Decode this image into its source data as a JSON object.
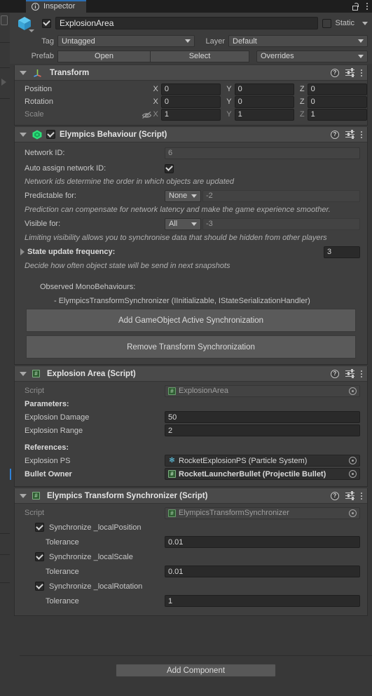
{
  "window": {
    "tab_label": "Inspector",
    "tab_icon": "info-icon",
    "lock_icon": "unlocked-padlock-icon",
    "menu_icon": "kebab-menu-icon",
    "accent_color": "#2c6fb4"
  },
  "gameobject": {
    "prefab_icon": "blue-cube-prefab-icon",
    "enabled": true,
    "name": "ExplosionArea",
    "static_label": "Static",
    "static_checked": false,
    "tag_label": "Tag",
    "tag_value": "Untagged",
    "layer_label": "Layer",
    "layer_value": "Default",
    "prefab_label": "Prefab",
    "prefab_open": "Open",
    "prefab_select": "Select",
    "prefab_overrides": "Overrides"
  },
  "components": [
    {
      "title": "Transform",
      "icon": "transform-axes-icon",
      "expanded": true,
      "has_enable_checkbox": false,
      "rows": [
        {
          "label": "Position",
          "x": "0",
          "y": "0",
          "z": "0"
        },
        {
          "label": "Rotation",
          "x": "0",
          "y": "0",
          "z": "0"
        },
        {
          "label": "Scale",
          "x": "1",
          "y": "1",
          "z": "1",
          "dim": true,
          "link_icon": "eye-off-icon"
        }
      ],
      "axis_labels": [
        "X",
        "Y",
        "Z"
      ]
    },
    {
      "title": "Elympics Behaviour (Script)",
      "icon": "elympics-green-gem-icon",
      "expanded": true,
      "has_enable_checkbox": true,
      "enabled": true,
      "network_id_label": "Network ID:",
      "network_id_value": "6",
      "auto_assign_label": "Auto assign network ID:",
      "auto_assign_checked": true,
      "auto_assign_help": "Network ids determine the order in which objects are updated",
      "predictable_label": "Predictable for:",
      "predictable_value": "None",
      "predictable_extra": "-2",
      "predictable_help": "Prediction can compensate for network latency and make the game experience smoother.",
      "visible_label": "Visible for:",
      "visible_value": "All",
      "visible_extra": "-3",
      "visible_help": "Limiting visibility allows you to synchronise data that should be hidden from other players",
      "state_freq_label": "State update frequency:",
      "state_freq_value": "3",
      "state_freq_help": "Decide how often object state will be send in next snapshots",
      "observed_label": "Observed MonoBehaviours:",
      "observed_items": [
        "- ElympicsTransformSynchronizer (IInitializable, IStateSerializationHandler)"
      ],
      "btn_add_sync": "Add GameObject Active Synchronization",
      "btn_remove_sync": "Remove Transform Synchronization"
    },
    {
      "title": "Explosion Area (Script)",
      "icon": "csharp-script-icon",
      "expanded": true,
      "has_enable_checkbox": false,
      "script_label": "Script",
      "script_value": "ExplosionArea",
      "parameters_header": "Parameters:",
      "parameters": [
        {
          "label": "Explosion Damage",
          "value": "50"
        },
        {
          "label": "Explosion Range",
          "value": "2"
        }
      ],
      "references_header": "References:",
      "references": [
        {
          "label": "Explosion PS",
          "value": "RocketExplosionPS (Particle System)",
          "icon": "particle-system-icon",
          "overridden": false
        },
        {
          "label": "Bullet Owner",
          "value": "RocketLauncherBullet (Projectile Bullet)",
          "icon": "csharp-script-icon",
          "overridden": true
        }
      ]
    },
    {
      "title": "Elympics Transform Synchronizer (Script)",
      "icon": "csharp-script-icon",
      "expanded": true,
      "has_enable_checkbox": false,
      "script_label": "Script",
      "script_value": "ElympicsTransformSynchronizer",
      "toggles": [
        {
          "label": "Synchronize _localPosition",
          "checked": true,
          "tolerance_label": "Tolerance",
          "tolerance_value": "0.01"
        },
        {
          "label": "Synchronize _localScale",
          "checked": true,
          "tolerance_label": "Tolerance",
          "tolerance_value": "0.01"
        },
        {
          "label": "Synchronize _localRotation",
          "checked": true,
          "tolerance_label": "Tolerance",
          "tolerance_value": "1"
        }
      ]
    }
  ],
  "footer": {
    "add_component_label": "Add Component"
  }
}
